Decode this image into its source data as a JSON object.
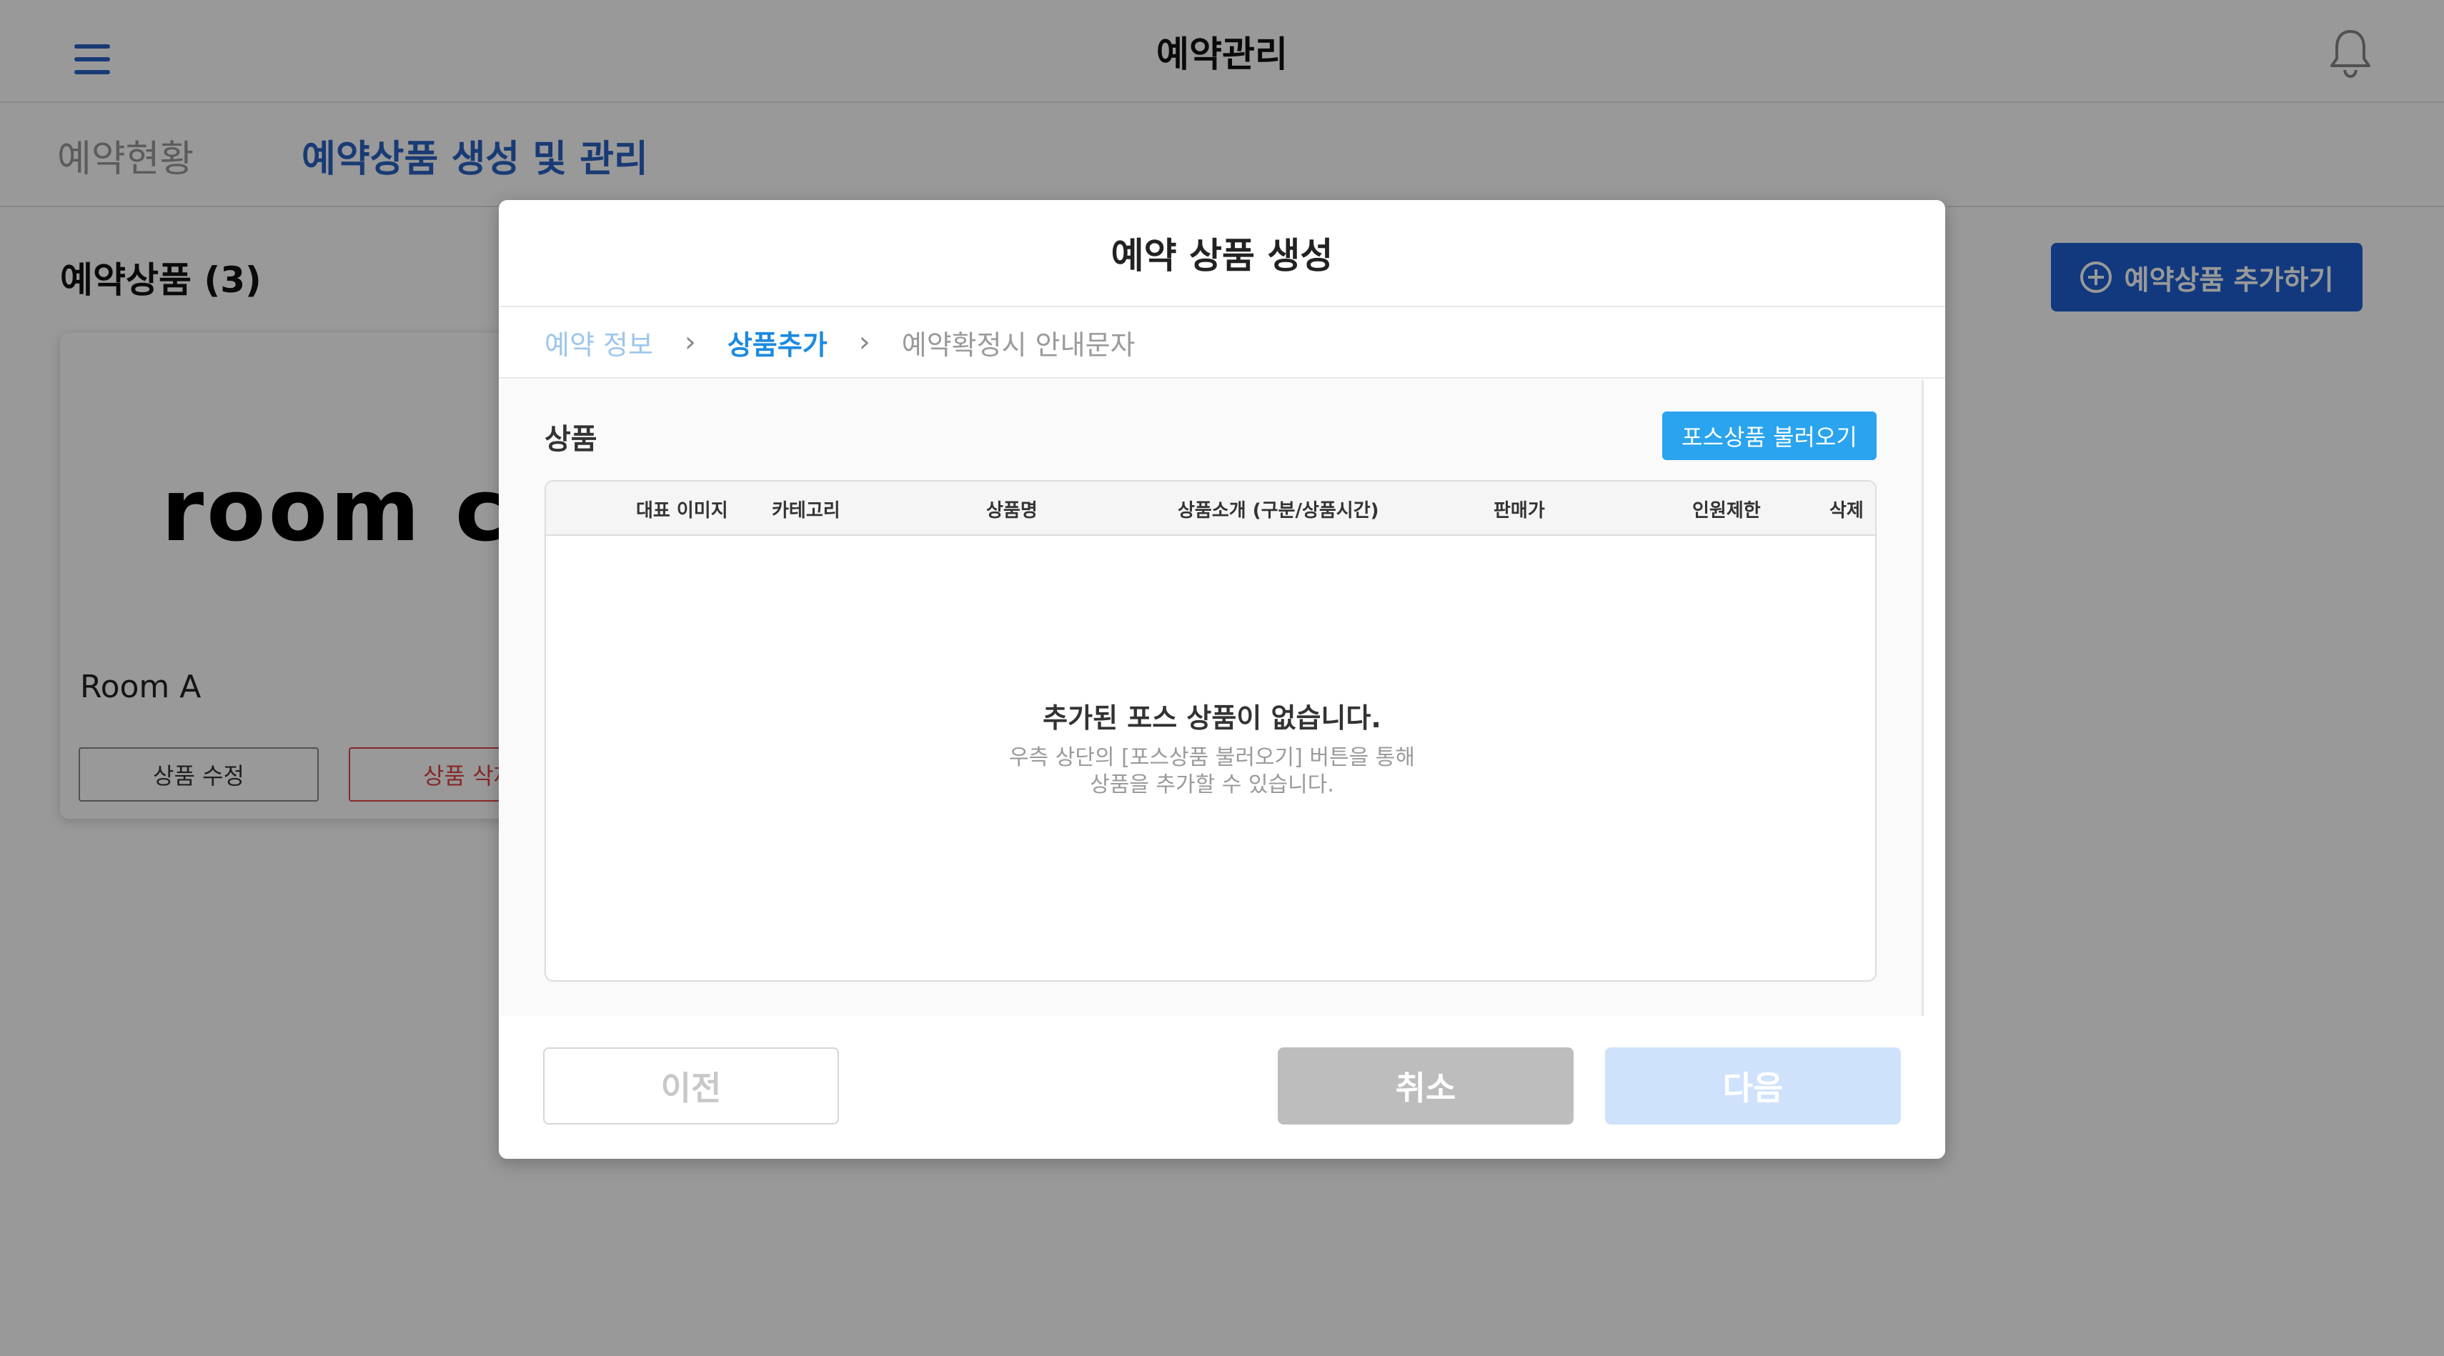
{
  "header": {
    "title": "예약관리"
  },
  "tabs": [
    {
      "label": "예약현황"
    },
    {
      "label": "예약상품 생성 및 관리"
    }
  ],
  "page": {
    "section_title": "예약상품 (3)",
    "add_button_label": "예약상품 추가하기"
  },
  "card": {
    "logo_text": "room c",
    "name": "Room A",
    "edit_label": "상품 수정",
    "delete_label": "상품 삭제"
  },
  "modal": {
    "title": "예약 상품 생성",
    "steps": [
      {
        "label": "예약 정보"
      },
      {
        "label": "상품추가"
      },
      {
        "label": "예약확정시 안내문자"
      }
    ],
    "products_label": "상품",
    "import_button_label": "포스상품 불러오기",
    "columns": [
      "대표 이미지",
      "카테고리",
      "상품명",
      "상품소개 (구분/상품시간)",
      "판매가",
      "인원제한",
      "삭제"
    ],
    "empty_title": "추가된 포스 상품이 없습니다.",
    "empty_desc_line1": "우측 상단의 [포스상품 불러오기] 버튼을 통해",
    "empty_desc_line2": "상품을 추가할 수 있습니다.",
    "prev_label": "이전",
    "cancel_label": "취소",
    "next_label": "다음"
  },
  "colors": {
    "primary": "#1f5fd1",
    "accent": "#2aa4ee",
    "overlay": "rgba(0,0,0,0.40)"
  }
}
